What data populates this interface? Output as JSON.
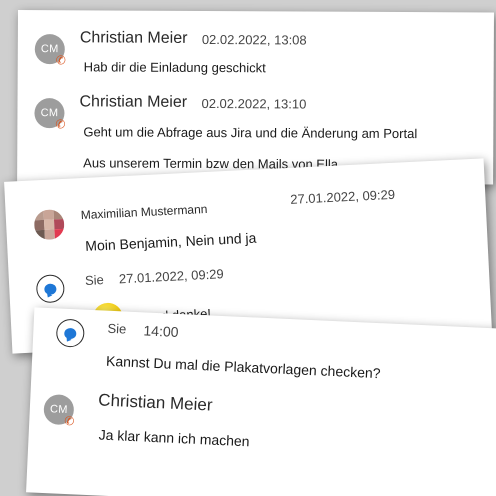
{
  "card1": {
    "entries": [
      {
        "avatar_initials": "CM",
        "name": "Christian Meier",
        "time": "02.02.2022, 13:08",
        "messages": [
          "Hab dir die Einladung geschickt"
        ]
      },
      {
        "avatar_initials": "CM",
        "name": "Christian Meier",
        "time": "02.02.2022, 13:10",
        "messages": [
          "Geht um die Abfrage aus Jira und die Änderung am Portal",
          "Aus unserem Termin bzw den Mails von Ella"
        ]
      }
    ]
  },
  "card2": {
    "entries": [
      {
        "name": "Maximilian Mustermann",
        "time": "27.01.2022, 09:29",
        "messages": [
          "Moin Benjamin, Nein und ja"
        ]
      },
      {
        "name": "Sie",
        "time": "27.01.2022, 09:29",
        "messages": [
          "...und danke!"
        ]
      }
    ]
  },
  "card3": {
    "entries": [
      {
        "name": "Sie",
        "time": "14:00",
        "messages": [
          "Kannst Du mal die Plakatvorlagen checken?"
        ]
      },
      {
        "avatar_initials": "CM",
        "name": "Christian Meier",
        "messages": [
          "Ja klar kann ich machen"
        ]
      }
    ]
  },
  "icons": {
    "call_badge": "phone-icon",
    "self_avatar": "chat-bubble-icon",
    "emoji": "smiley-emoji-icon"
  },
  "colors": {
    "call_badge": "#d9541e",
    "chat_bubble": "#1e77d6",
    "avatar_bg": "#9d9d9d"
  }
}
